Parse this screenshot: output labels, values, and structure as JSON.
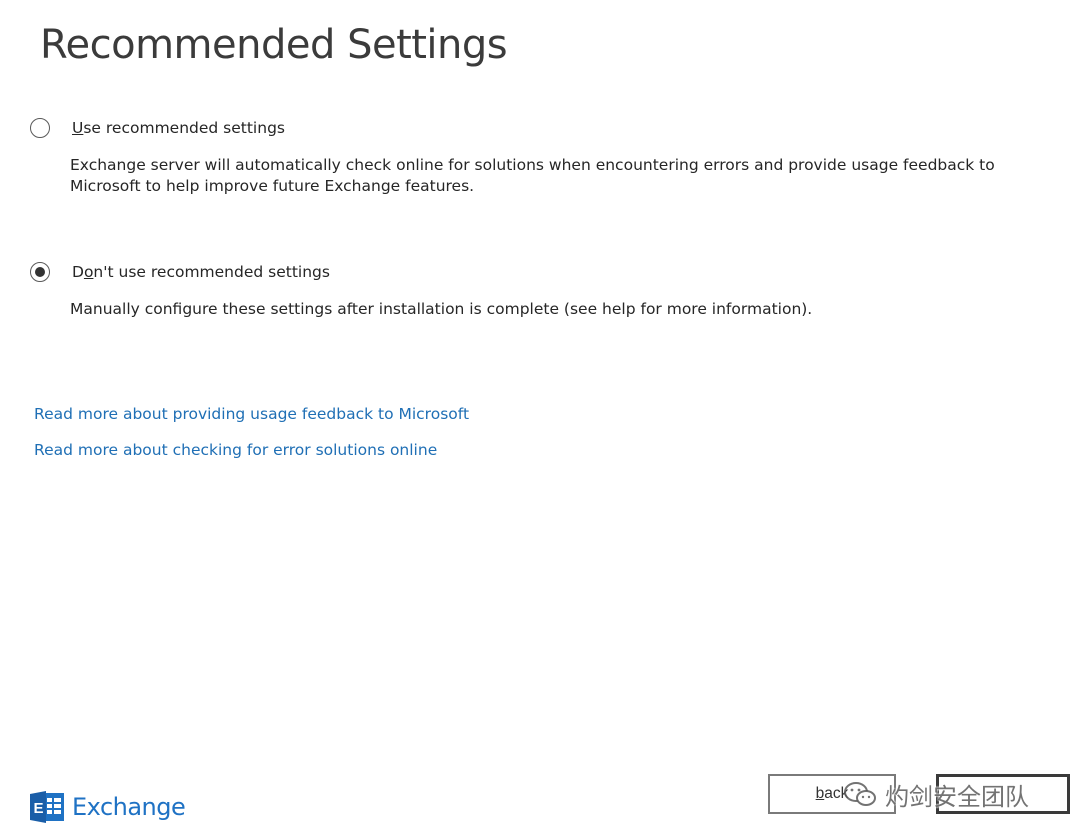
{
  "page": {
    "title": "Recommended Settings"
  },
  "options": [
    {
      "label_mnemonic": "U",
      "label_rest": "se recommended settings",
      "description": "Exchange server will automatically check online for solutions when encountering errors and provide usage feedback to Microsoft to help improve future Exchange features.",
      "selected": false
    },
    {
      "label_pre": "D",
      "label_mnemonic": "o",
      "label_rest": "n't use recommended settings",
      "description": "Manually configure these settings after installation is complete (see help for more information).",
      "selected": true
    }
  ],
  "links": {
    "usage_feedback": "Read more about providing usage feedback to Microsoft",
    "error_solutions": "Read more about checking for error solutions online"
  },
  "logo": {
    "text": "Exchange",
    "icon": "exchange-logo-icon",
    "color": "#1f72c4"
  },
  "buttons": {
    "back_mnemonic": "b",
    "back_rest": "ack",
    "next_label": ""
  },
  "watermark": {
    "text": "灼剑安全团队",
    "icon": "wechat-icon"
  },
  "colors": {
    "link": "#1f6fb5",
    "title": "#3b3b3b"
  }
}
